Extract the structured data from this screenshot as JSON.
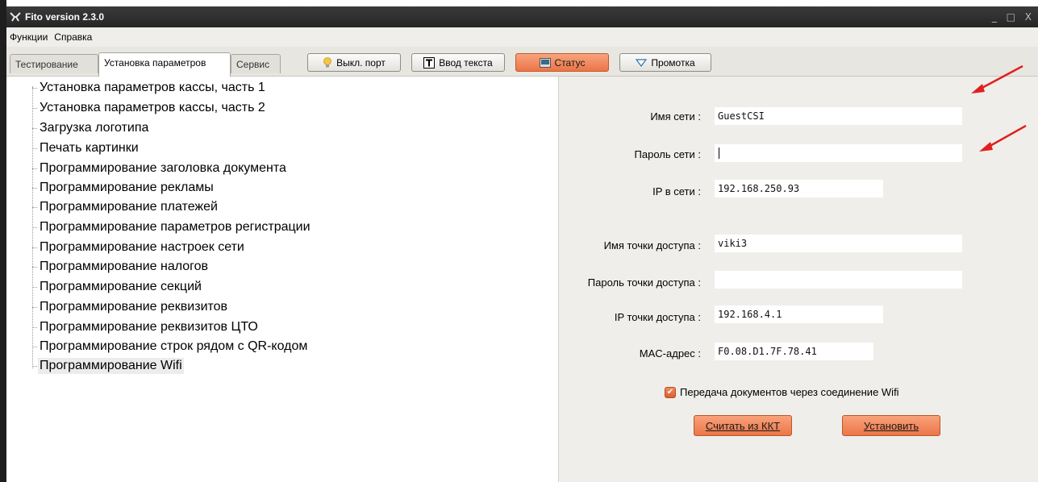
{
  "window": {
    "title": "Fito version 2.3.0",
    "controls": "_ □ X"
  },
  "menu": {
    "items": [
      "Функции",
      "Справка"
    ]
  },
  "tabs": [
    "Тестирование",
    "Установка параметров",
    "Сервис"
  ],
  "active_tab": "Установка параметров",
  "toolbar": {
    "port_label": "Выкл. порт",
    "text_input_label": "Ввод текста",
    "status_label": "Статус",
    "scroll_label": "Промотка"
  },
  "tree": {
    "items": [
      "Установка параметров кассы, часть 1",
      "Установка параметров кассы, часть 2",
      "Загрузка логотипа",
      "Печать картинки",
      "Программирование заголовка документа",
      "Программирование рекламы",
      "Программирование платежей",
      "Программирование параметров регистрации",
      "Программирование настроек сети",
      "Программирование налогов",
      "Программирование секций",
      "Программирование реквизитов",
      "Программирование реквизитов ЦТО",
      "Программирование строк рядом с QR-кодом",
      "Программирование Wifi"
    ],
    "selected": "Программирование Wifi"
  },
  "wifi": {
    "network_name_label": "Имя сети :",
    "network_name_value": "GuestCSI",
    "network_password_label": "Пароль сети :",
    "network_password_value": "",
    "network_ip_label": "IP в сети :",
    "network_ip_value": "192.168.250.93",
    "ap_name_label": "Имя точки доступа :",
    "ap_name_value": "viki3",
    "ap_password_label": "Пароль точки доступа :",
    "ap_password_value": "",
    "ap_ip_label": "IP точки доступа :",
    "ap_ip_value": "192.168.4.1",
    "mac_label": "MAC-адрес :",
    "mac_value": "F0.08.D1.7F.78.41",
    "transfer_checkbox_label": "Передача документов через соединение Wifi",
    "transfer_checked": true,
    "read_button": "Считать из ККТ",
    "set_button": "Установить"
  },
  "colors": {
    "accent_orange": "#ec7446",
    "annotation_arrow": "#e02020",
    "titlebar": "#2e2e2e"
  }
}
